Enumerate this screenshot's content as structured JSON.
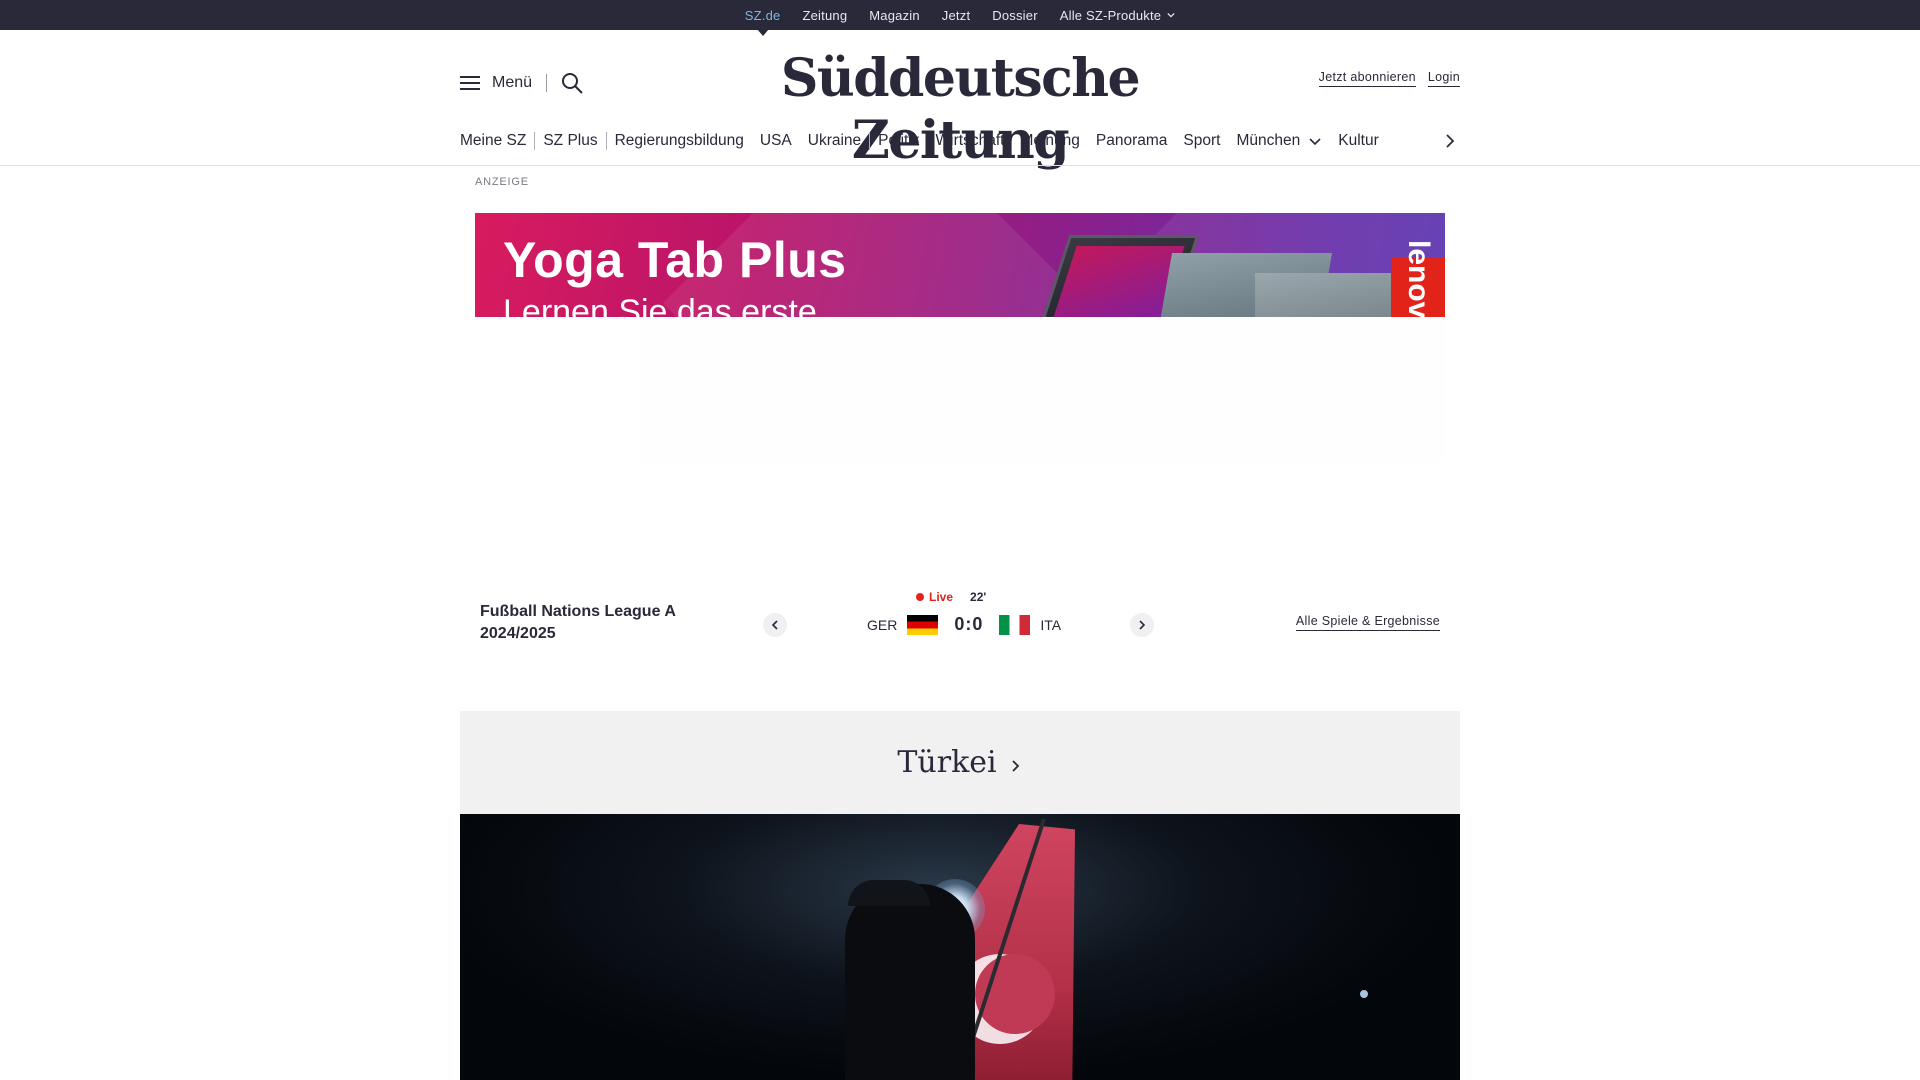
{
  "topbar": {
    "items": [
      {
        "label": "SZ.de",
        "active": true
      },
      {
        "label": "Zeitung",
        "active": false
      },
      {
        "label": "Magazin",
        "active": false
      },
      {
        "label": "Jetzt",
        "active": false
      },
      {
        "label": "Dossier",
        "active": false
      },
      {
        "label": "Alle SZ-Produkte",
        "active": false,
        "dropdown": true
      }
    ],
    "colors": {
      "background": "#29293a",
      "active": "#7fb8d9"
    }
  },
  "header": {
    "menu_label": "Menü",
    "logo_text": "Süddeutsche Zeitung",
    "subscribe_label": "Jetzt abonnieren",
    "login_label": "Login",
    "icons": {
      "menu": "hamburger-icon",
      "search": "search-icon"
    }
  },
  "catnav": {
    "items": [
      "Meine SZ",
      "SZ Plus",
      "Regierungsbildung",
      "USA",
      "Ukraine",
      "Politik",
      "Wirtschaft",
      "Meinung",
      "Panorama",
      "Sport",
      "München",
      "Kultur"
    ],
    "dropdown_item": "München",
    "next_icon": "chevron-right-icon"
  },
  "ad": {
    "label": "ANZEIGE",
    "title": "Yoga Tab Plus",
    "subtitle": "Lernen Sie das erste",
    "brand": "lenovo",
    "colors": {
      "brand": "#e2231a",
      "gradient_start": "#d81b5e",
      "gradient_end": "#5a35b0"
    }
  },
  "ticker": {
    "competition": "Fußball Nations League A 2024/2025",
    "live_label": "Live",
    "minute": "22'",
    "home_team": "GER",
    "away_team": "ITA",
    "score": "0:0",
    "all_games_label": "Alle Spiele & Ergebnisse",
    "colors": {
      "live": "#e2231a"
    }
  },
  "topic": {
    "label": "Türkei",
    "icon": "chevron-right-icon"
  },
  "hero": {
    "image_subject": "silhouette-with-turkish-flag"
  }
}
